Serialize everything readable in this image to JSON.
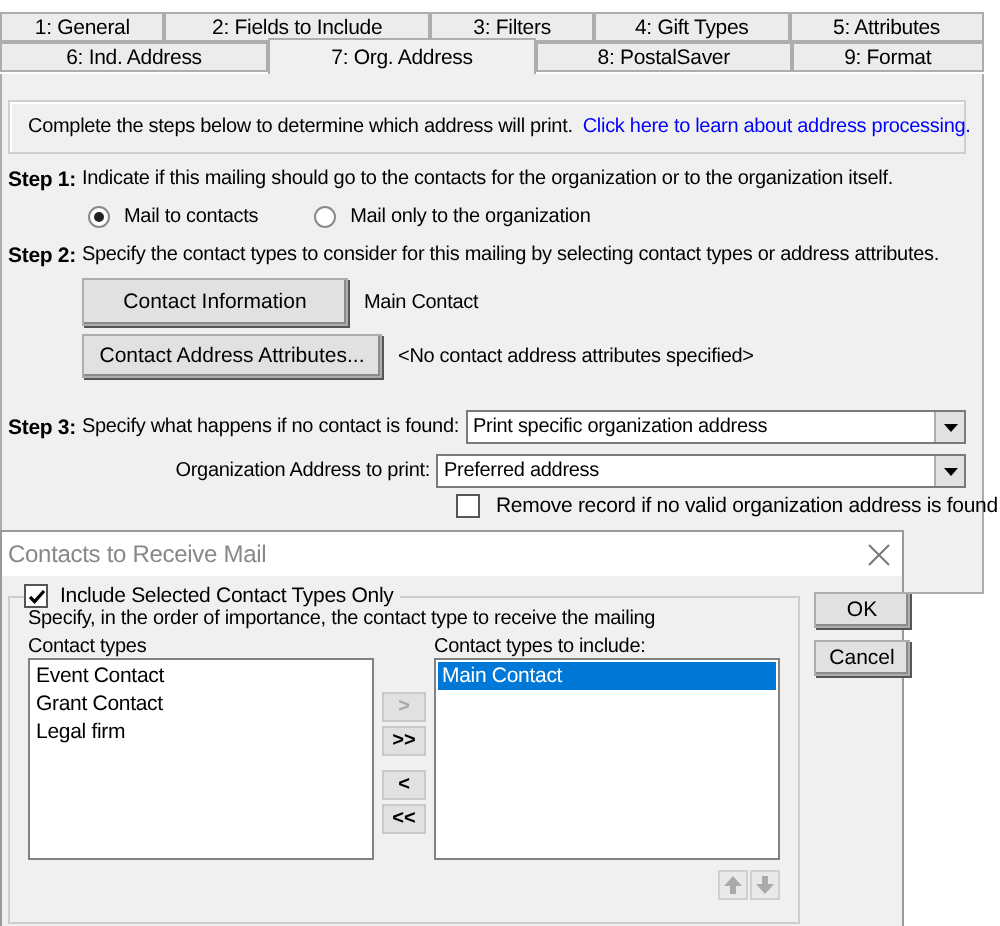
{
  "tabs": [
    [
      {
        "label": "1: General",
        "selected": false
      },
      {
        "label": "2: Fields to Include",
        "selected": false
      },
      {
        "label": "3: Filters",
        "selected": false
      },
      {
        "label": "4: Gift Types",
        "selected": false
      },
      {
        "label": "5: Attributes",
        "selected": false
      }
    ],
    [
      {
        "label": "6: Ind. Address",
        "selected": false
      },
      {
        "label": "7: Org. Address",
        "selected": true
      },
      {
        "label": "8: PostalSaver",
        "selected": false
      },
      {
        "label": "9: Format",
        "selected": false
      }
    ]
  ],
  "info": {
    "text": "Complete the steps below to determine which address will print.",
    "link": "Click here to learn about address processing."
  },
  "step1": {
    "label": "Step 1:",
    "text": "Indicate if this mailing should go to the contacts for the organization or to the organization itself.",
    "options": [
      {
        "label": "Mail to contacts",
        "selected": true
      },
      {
        "label": "Mail only to the organization",
        "selected": false
      }
    ]
  },
  "step2": {
    "label": "Step 2:",
    "text": "Specify the contact types to consider for this mailing by selecting contact types or address attributes.",
    "rows": [
      {
        "button": "Contact Information",
        "value": "Main Contact"
      },
      {
        "button": "Contact Address Attributes...",
        "value": "<No contact address attributes specified>"
      }
    ]
  },
  "step3": {
    "label": "Step 3:",
    "text": "Specify what happens if no contact is found:",
    "value": "Print specific organization address"
  },
  "org_address": {
    "label": "Organization Address to print:",
    "value": "Preferred address"
  },
  "remove_record": {
    "label": "Remove record if no valid organization address is found",
    "checked": false
  },
  "dialog": {
    "title": "Contacts to Receive Mail",
    "include_only": {
      "label": "Include Selected Contact Types Only",
      "checked": true
    },
    "instructions": "Specify, in the order of importance, the contact type to receive the mailing",
    "available": {
      "label": "Contact types",
      "items": [
        {
          "label": "Event Contact",
          "selected": false
        },
        {
          "label": "Grant Contact",
          "selected": false
        },
        {
          "label": "Legal firm",
          "selected": false
        }
      ]
    },
    "included": {
      "label": "Contact types to include:",
      "items": [
        {
          "label": "Main Contact",
          "selected": true
        }
      ]
    },
    "move_buttons": [
      {
        "label": ">",
        "disabled": true
      },
      {
        "label": ">>",
        "disabled": false
      },
      {
        "label": "<",
        "disabled": false
      },
      {
        "label": "<<",
        "disabled": false
      }
    ],
    "order_buttons": [
      {
        "kind": "up",
        "disabled": true
      },
      {
        "kind": "down",
        "disabled": true
      }
    ],
    "buttons": [
      {
        "label": "OK"
      },
      {
        "label": "Cancel"
      }
    ]
  }
}
